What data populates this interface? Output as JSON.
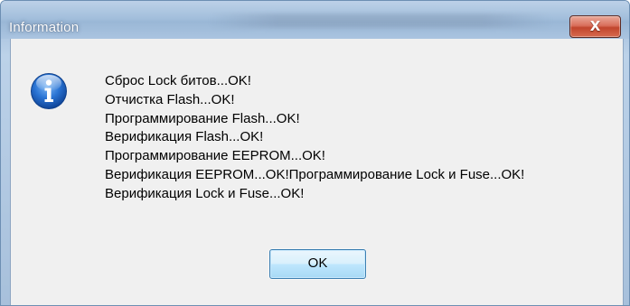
{
  "window": {
    "title": "Information",
    "close_label": "X"
  },
  "dialog": {
    "icon": "info-icon",
    "messages": [
      "Сброс Lock битов...OK!",
      "Отчистка Flash...OK!",
      "Программирование Flash...OK!",
      "Верификация Flash...OK!",
      "Программирование EEPROM...OK!",
      "Верификация EEPROM...OK!Программирование Lock и Fuse...OK!",
      "Верификация Lock и Fuse...OK!"
    ],
    "ok_label": "OK"
  },
  "colors": {
    "title_bar": "#a3bfdc",
    "close_button": "#c1452d",
    "client_background": "#f0f0f0",
    "info_icon": "#1f67c8",
    "ok_button_border": "#3c7fb1"
  }
}
